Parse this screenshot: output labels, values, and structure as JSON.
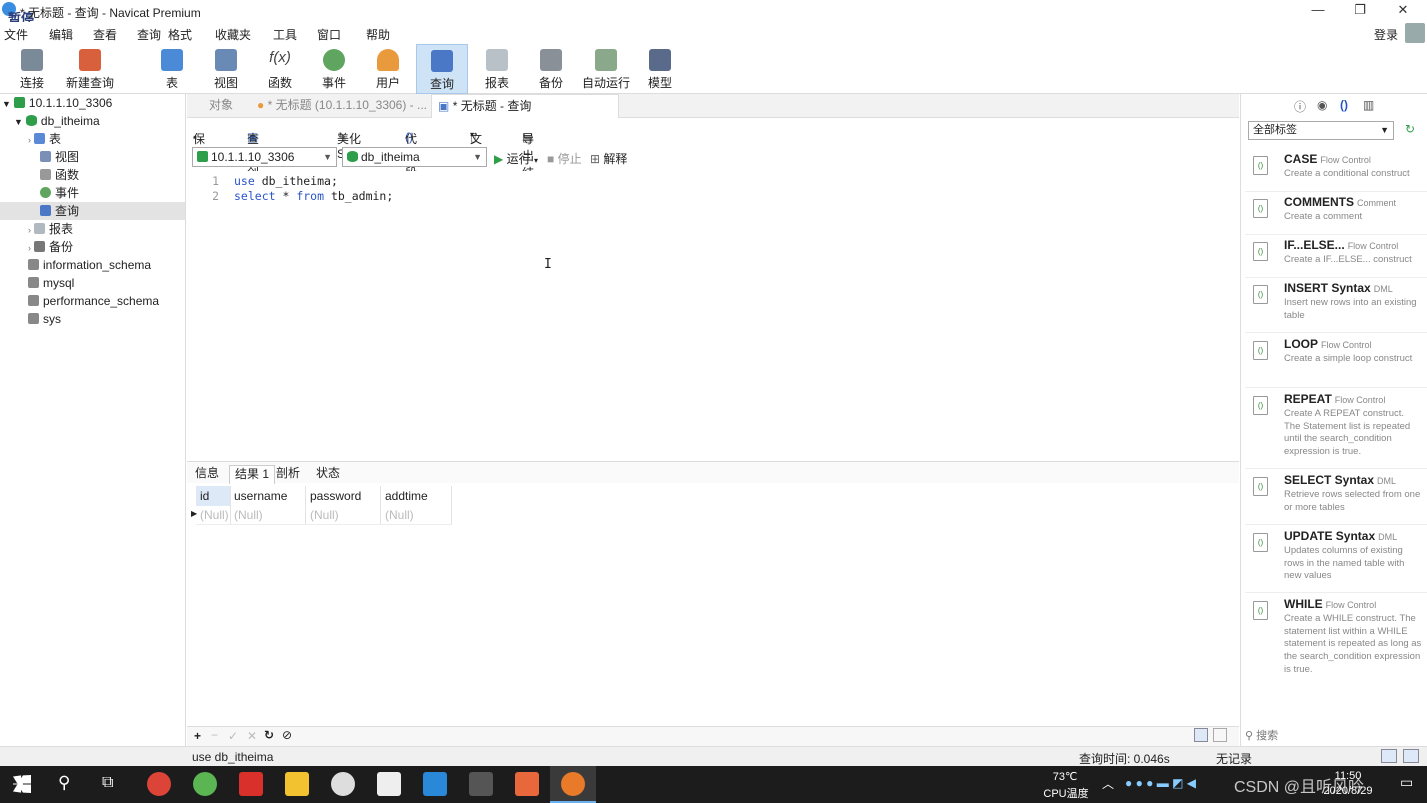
{
  "window": {
    "title": "* 无标题 - 查询 - Navicat Premium",
    "login": "登录",
    "overlay_logo": "暂停"
  },
  "menu": [
    "文件",
    "编辑",
    "查看",
    "查询",
    "格式",
    "收藏夹",
    "工具",
    "窗口",
    "帮助"
  ],
  "toolbar": {
    "items": [
      {
        "label": "连接",
        "icon": "plug-icon"
      },
      {
        "label": "新建查询",
        "icon": "new-query-icon"
      },
      {
        "label": "表",
        "icon": "table-icon"
      },
      {
        "label": "视图",
        "icon": "view-icon"
      },
      {
        "label": "函数",
        "icon": "function-icon"
      },
      {
        "label": "事件",
        "icon": "clock-icon"
      },
      {
        "label": "用户",
        "icon": "user-icon"
      },
      {
        "label": "查询",
        "icon": "query-icon"
      },
      {
        "label": "报表",
        "icon": "report-icon"
      },
      {
        "label": "备份",
        "icon": "backup-icon"
      },
      {
        "label": "自动运行",
        "icon": "schedule-icon"
      },
      {
        "label": "模型",
        "icon": "model-icon"
      }
    ],
    "fx_glyph": "f(x)"
  },
  "tree": {
    "connection": "10.1.1.10_3306",
    "database": "db_itheima",
    "children": [
      "表",
      "视图",
      "函数",
      "事件",
      "查询",
      "报表",
      "备份"
    ],
    "other_dbs": [
      "information_schema",
      "mysql",
      "performance_schema",
      "sys"
    ]
  },
  "tabs": [
    {
      "label": "对象"
    },
    {
      "label": "* 无标题 (10.1.1.10_3306) - ..."
    },
    {
      "label": "* 无标题 - 查询"
    }
  ],
  "query_toolbar": {
    "save": "保存",
    "builder": "查询创建工具",
    "beautify": "美化 SQL",
    "snippet": "代码段",
    "text": "文本",
    "export": "导出结果",
    "run": "运行",
    "stop": "停止",
    "explain": "解释"
  },
  "selectors": {
    "connection": "10.1.1.10_3306",
    "database": "db_itheima"
  },
  "editor": {
    "lines": [
      {
        "num": "1",
        "kw": "use",
        "rest": " db_itheima;"
      },
      {
        "num": "2",
        "kw": "select",
        "rest": " * ",
        "kw2": "from",
        "rest2": " tb_admin;"
      }
    ]
  },
  "result_tabs": [
    "信息",
    "结果 1",
    "剖析",
    "状态"
  ],
  "grid": {
    "columns": [
      "id",
      "username",
      "password",
      "addtime"
    ],
    "row": [
      "(Null)",
      "(Null)",
      "(Null)",
      "(Null)"
    ]
  },
  "right_panel": {
    "filter": "全部标签",
    "search": "搜索",
    "snippets": [
      {
        "name": "CASE",
        "cat": "Flow Control",
        "desc": "Create a conditional construct"
      },
      {
        "name": "COMMENTS",
        "cat": "Comment",
        "desc": "Create a comment"
      },
      {
        "name": "IF...ELSE...",
        "cat": "Flow Control",
        "desc": "Create a IF...ELSE... construct"
      },
      {
        "name": "INSERT Syntax",
        "cat": "DML",
        "desc": "Insert new rows into an existing table"
      },
      {
        "name": "LOOP",
        "cat": "Flow Control",
        "desc": "Create a simple loop construct"
      },
      {
        "name": "REPEAT",
        "cat": "Flow Control",
        "desc": "Create A REPEAT construct. The Statement list is repeated until the search_condition expression is true."
      },
      {
        "name": "SELECT Syntax",
        "cat": "DML",
        "desc": "Retrieve rows selected from one or more tables"
      },
      {
        "name": "UPDATE Syntax",
        "cat": "DML",
        "desc": "Updates columns of existing rows in the named table with new values"
      },
      {
        "name": "WHILE",
        "cat": "Flow Control",
        "desc": "Create a WHILE construct. The statement list within a WHILE statement is repeated as long as the search_condition expression is true."
      }
    ]
  },
  "status": {
    "sql": "use db_itheima",
    "time": "查询时间: 0.046s",
    "records": "无记录"
  },
  "taskbar": {
    "temp": "73℃",
    "temp_label": "CPU温度",
    "time": "11:50",
    "date": "2020/8/29",
    "watermark": "CSDN @且听风吟"
  },
  "colors": {
    "accent": "#2a55c8",
    "active_tool": "#cfe3f7",
    "taskbar": "#1c1c1c"
  }
}
